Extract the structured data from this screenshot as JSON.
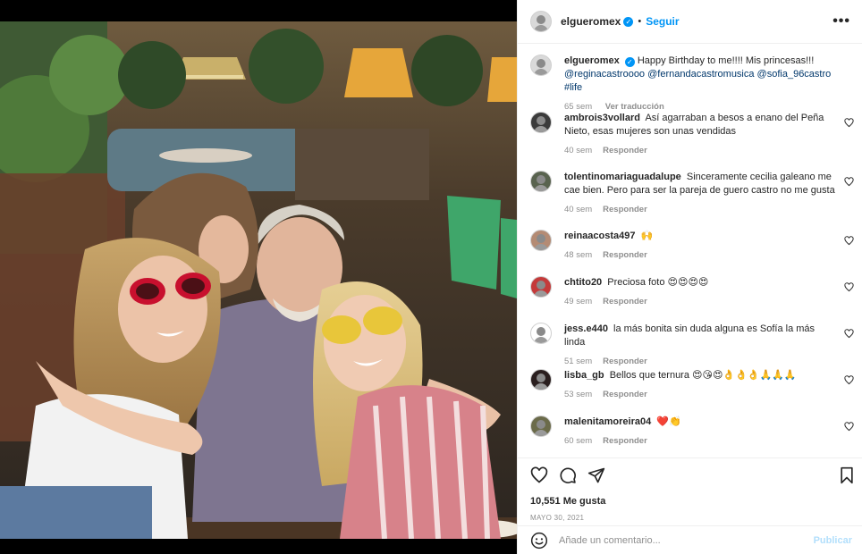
{
  "post": {
    "username": "elgueromex",
    "follow_label": "Seguir",
    "separator": "•",
    "more_label": "•••"
  },
  "caption": {
    "username": "elgueromex",
    "text": "Happy Birthday to me!!!! Mis princesas!!!",
    "mentions": "@reginacastroooo @fernandacastromusica @sofia_96castro #life",
    "time": "65 sem",
    "translate_label": "Ver traducción"
  },
  "comments": [
    {
      "username": "ambrois3vollard",
      "text": "Así agarraban a besos a enano del Peña Nieto, esas mujeres son unas vendidas",
      "time": "40 sem",
      "reply": "Responder"
    },
    {
      "username": "tolentinomariaguadalupe",
      "text": "Sinceramente cecilia galeano me cae bien. Pero para ser la pareja de guero castro no me gusta",
      "time": "40 sem",
      "reply": "Responder"
    },
    {
      "username": "reinaacosta497",
      "text": "🙌",
      "time": "48 sem",
      "reply": "Responder"
    },
    {
      "username": "chtito20",
      "text": "Preciosa foto 😍😍😍😍",
      "time": "49 sem",
      "reply": "Responder"
    },
    {
      "username": "jess.e440",
      "text": "la más bonita sin duda alguna es Sofía la más linda",
      "time": "51 sem",
      "reply": "Responder"
    },
    {
      "username": "lisba_gb",
      "text": "Bellos que ternura 😍😘😍👌👌👌🙏🙏🙏",
      "time": "53 sem",
      "reply": "Responder"
    },
    {
      "username": "malenitamoreira04",
      "text": "❤️👏",
      "time": "60 sem",
      "reply": "Responder"
    }
  ],
  "engagement": {
    "likes": "10,551 Me gusta",
    "date": "MAYO 30, 2021"
  },
  "composer": {
    "placeholder": "Añade un comentario...",
    "publish_label": "Publicar"
  },
  "colors": {
    "accent": "#0095f6",
    "mention": "#00376b",
    "muted": "#8e8e8e",
    "publish_disabled": "#b2dffc"
  },
  "icons": [
    "heart-icon",
    "comment-icon",
    "share-icon",
    "bookmark-icon",
    "emoji-icon",
    "verified-badge-icon",
    "more-options-icon"
  ]
}
